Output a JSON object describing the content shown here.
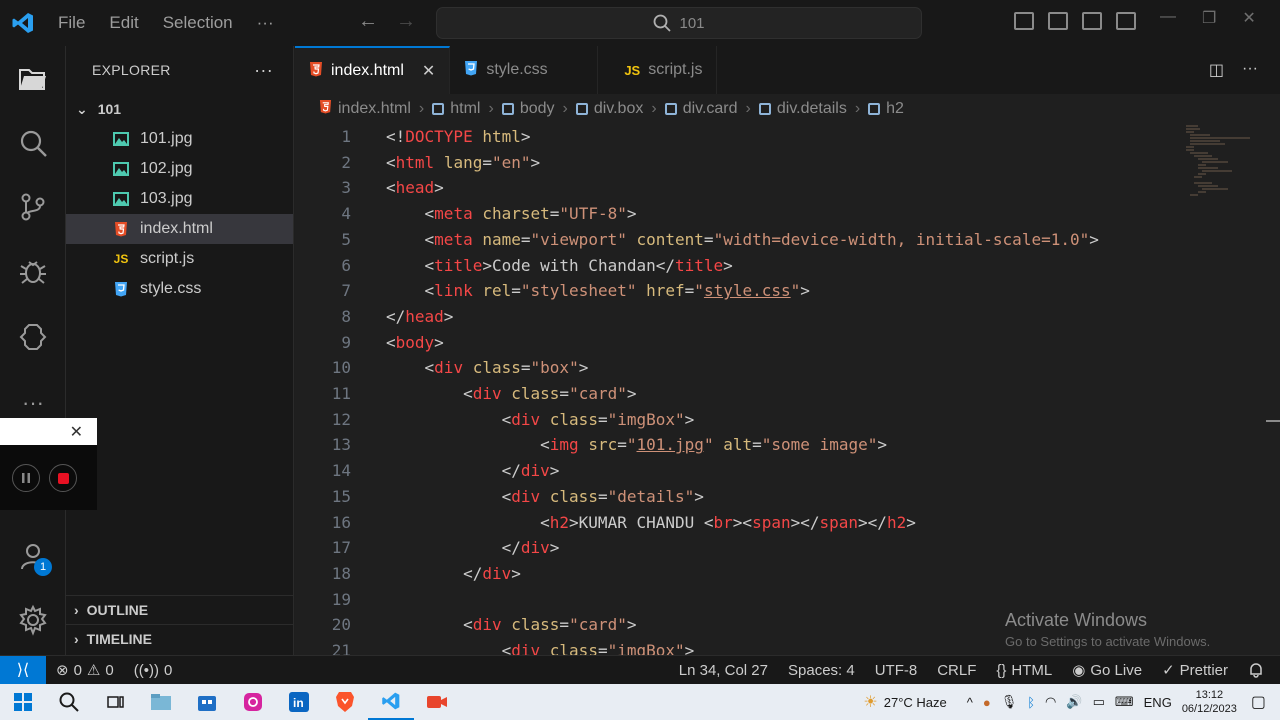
{
  "menu": {
    "file": "File",
    "edit": "Edit",
    "selection": "Selection",
    "more": "···"
  },
  "search": {
    "text": "101"
  },
  "explorer": {
    "title": "EXPLORER",
    "folder": "101",
    "files": [
      {
        "name": "101.jpg",
        "icon": "image-icon"
      },
      {
        "name": "102.jpg",
        "icon": "image-icon"
      },
      {
        "name": "103.jpg",
        "icon": "image-icon"
      },
      {
        "name": "index.html",
        "icon": "html-icon"
      },
      {
        "name": "script.js",
        "icon": "js-icon"
      },
      {
        "name": "style.css",
        "icon": "css-icon"
      }
    ],
    "outline": "OUTLINE",
    "timeline": "TIMELINE"
  },
  "tabs": [
    {
      "label": "index.html",
      "active": true
    },
    {
      "label": "style.css",
      "active": false
    },
    {
      "label": "script.js",
      "active": false
    }
  ],
  "breadcrumbs": [
    "index.html",
    "html",
    "body",
    "div.box",
    "div.card",
    "div.details",
    "h2"
  ],
  "code": {
    "line_numbers": [
      "1",
      "2",
      "3",
      "4",
      "5",
      "6",
      "7",
      "8",
      "9",
      "10",
      "11",
      "12",
      "13",
      "14",
      "15",
      "16",
      "17",
      "18",
      "19",
      "20",
      "21"
    ]
  },
  "watermark": {
    "title": "Activate Windows",
    "subtitle": "Go to Settings to activate Windows."
  },
  "status": {
    "errors": "0",
    "warnings": "0",
    "ports": "0",
    "position": "Ln 34, Col 27",
    "spaces": "Spaces: 4",
    "encoding": "UTF-8",
    "eol": "CRLF",
    "language": "HTML",
    "golive": "Go Live",
    "prettier": "Prettier"
  },
  "badges": {
    "accounts": "1"
  },
  "taskbar": {
    "weather": "27°C  Haze",
    "lang": "ENG",
    "time": "13:12",
    "date": "06/12/2023"
  },
  "colors": {
    "accent": "#0078d4",
    "tag": "#f44747",
    "attr": "#d7ba7d",
    "string": "#ce9178"
  }
}
